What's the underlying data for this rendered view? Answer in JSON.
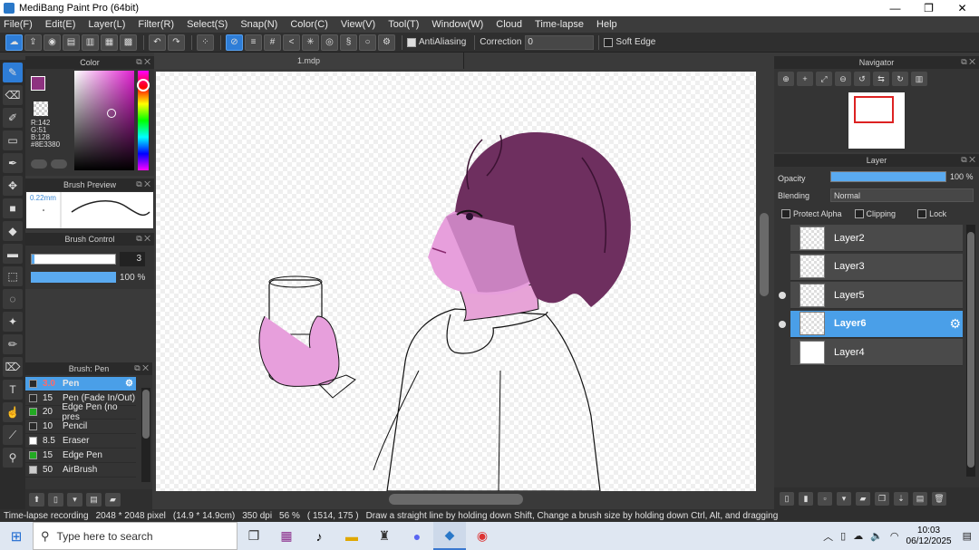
{
  "window": {
    "title": "MediBang Paint Pro (64bit)",
    "minimize": "—",
    "maximize": "❐",
    "close": "✕"
  },
  "menu": [
    "File(F)",
    "Edit(E)",
    "Layer(L)",
    "Filter(R)",
    "Select(S)",
    "Snap(N)",
    "Color(C)",
    "View(V)",
    "Tool(T)",
    "Window(W)",
    "Cloud",
    "Time-lapse",
    "Help"
  ],
  "toolbar": {
    "antialiasing_label": "AntiAliasing",
    "correction_label": "Correction",
    "correction_value": "0",
    "soft_edge_label": "Soft Edge"
  },
  "color_panel": {
    "title": "Color",
    "foreground": "#8E3380",
    "r": "R:142",
    "g": "G:51",
    "b": "B:128",
    "hex": "#8E3380"
  },
  "brush_preview": {
    "title": "Brush Preview",
    "size": "0.22mm"
  },
  "brush_control": {
    "title": "Brush Control",
    "size_value": "3",
    "opacity_value": "100 %",
    "opacity_fraction": 1.0
  },
  "brush_list": {
    "title": "Brush: Pen",
    "items": [
      {
        "size": "3.0",
        "name": "Pen",
        "color": "#2a2a2a",
        "selected": true
      },
      {
        "size": "15",
        "name": "Pen (Fade In/Out)",
        "color": "#2a2a2a"
      },
      {
        "size": "20",
        "name": "Edge Pen (no pres",
        "color": "#22aa22"
      },
      {
        "size": "10",
        "name": "Pencil",
        "color": "#2a2a2a"
      },
      {
        "size": "8.5",
        "name": "Eraser",
        "color": "#ffffff"
      },
      {
        "size": "15",
        "name": "Edge Pen",
        "color": "#22aa22"
      },
      {
        "size": "50",
        "name": "AirBrush",
        "color": "#cccccc"
      }
    ]
  },
  "document": {
    "tab": "1.mdp"
  },
  "navigator": {
    "title": "Navigator"
  },
  "layer_panel": {
    "title": "Layer",
    "opacity_label": "Opacity",
    "opacity_value": "100 %",
    "opacity_fraction": 1.0,
    "blending_label": "Blending",
    "blending_value": "Normal",
    "protect_alpha": "Protect Alpha",
    "clipping": "Clipping",
    "lock": "Lock",
    "layers": [
      {
        "name": "Layer2",
        "visible": false,
        "selected": false
      },
      {
        "name": "Layer3",
        "visible": false,
        "selected": false
      },
      {
        "name": "Layer5",
        "visible": true,
        "selected": false
      },
      {
        "name": "Layer6",
        "visible": true,
        "selected": true
      },
      {
        "name": "Layer4",
        "visible": false,
        "selected": false
      }
    ]
  },
  "status": {
    "recording": "Time-lapse recording",
    "pixels": "2048 * 2048 pixel",
    "cm": "(14.9 * 14.9cm)",
    "dpi": "350 dpi",
    "zoom": "56 %",
    "coords": "( 1514, 175 )",
    "hint": "Draw a straight line by holding down Shift, Change a brush size by holding down Ctrl, Alt, and dragging"
  },
  "taskbar": {
    "search_placeholder": "Type here to search",
    "time": "10:03",
    "date": "06/12/2025"
  }
}
